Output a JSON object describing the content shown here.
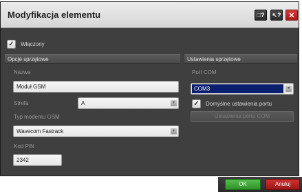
{
  "dialog": {
    "title": "Modyfikacja elementu",
    "title_buttons": [
      {
        "icon": "window-help-icon",
        "label": "□?"
      },
      {
        "icon": "pointer-help-icon",
        "label": "↖?"
      },
      {
        "icon": "close-icon",
        "label": "✕"
      }
    ]
  },
  "enabled": {
    "label": "Włączony",
    "checked": true,
    "mark": "✓"
  },
  "hardware_options": {
    "header": "Opcje sprzętowe",
    "name_label": "Nazwa",
    "name_value": "Moduł GSM",
    "zone_label": "Strefa",
    "zone_value": "A",
    "modem_type_label": "Typ modemu GSM",
    "modem_type_value": "Wavecom Fastrack",
    "pin_label": "Kod PIN",
    "pin_value": "2342",
    "dropdown_arrow": "▾"
  },
  "hardware_settings": {
    "header": "Ustawienia sprzętowe",
    "port_label": "Port COM",
    "port_value": "COM3",
    "default_port_label": "Domyślne ustawienia portu",
    "default_port_checked": true,
    "port_settings_button": "Ustawienia portu COM"
  },
  "footer": {
    "ok_label": "OK",
    "cancel_label": "Anuluj"
  },
  "colors": {
    "panel_bg": "#3f3f3f",
    "ok_green": "#3fa338",
    "cancel_red": "#b02020",
    "selection_navy": "#0a1f6e"
  }
}
